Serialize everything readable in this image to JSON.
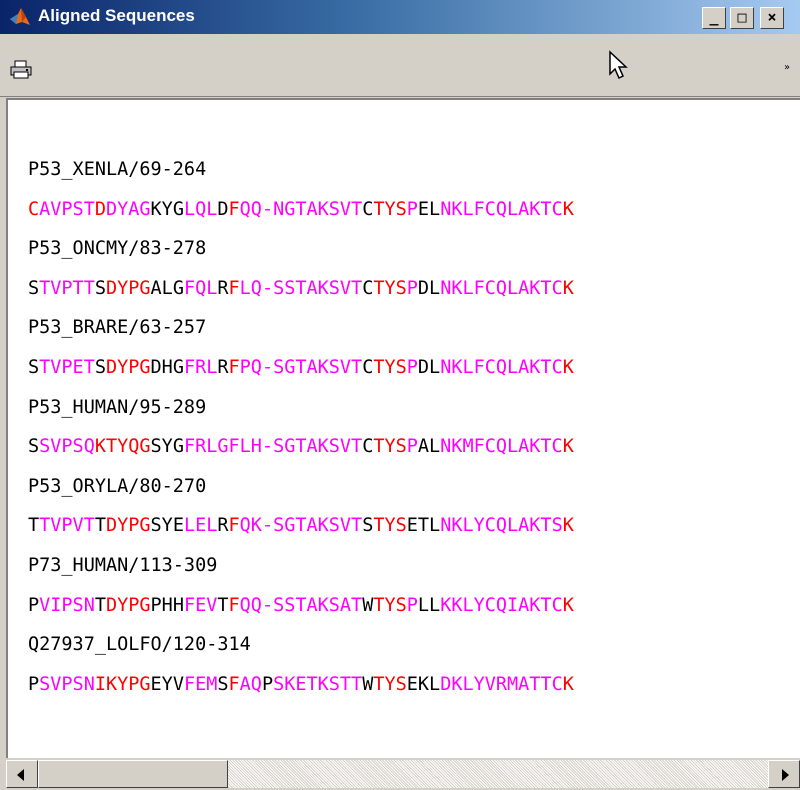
{
  "window": {
    "title": "Aligned Sequences",
    "controls": {
      "minimize": "_",
      "maximize": "□",
      "close": "×"
    }
  },
  "toolbar": {
    "print_icon": "printer-icon",
    "overflow_glyph": "»"
  },
  "colors": {
    "titlebar_start": "#0a246a",
    "titlebar_end": "#a6caf0",
    "residue_red": "#ff0000",
    "residue_magenta": "#ff00ff",
    "residue_black": "#000000"
  },
  "sequences": [
    {
      "name": "P53_XENLA/69-264",
      "segments": [
        {
          "t": "C",
          "c": "red"
        },
        {
          "t": "AVPST",
          "c": "magenta"
        },
        {
          "t": "D",
          "c": "red"
        },
        {
          "t": "DYAG",
          "c": "magenta"
        },
        {
          "t": "KYG",
          "c": "black"
        },
        {
          "t": "LQL",
          "c": "magenta"
        },
        {
          "t": "D",
          "c": "black"
        },
        {
          "t": "F",
          "c": "red"
        },
        {
          "t": "QQ-",
          "c": "magenta"
        },
        {
          "t": "NGTAKSVT",
          "c": "magenta"
        },
        {
          "t": "C",
          "c": "black"
        },
        {
          "t": "TYS",
          "c": "red"
        },
        {
          "t": "P",
          "c": "magenta"
        },
        {
          "t": "EL",
          "c": "black"
        },
        {
          "t": "NKLFCQLAKTC",
          "c": "magenta"
        },
        {
          "t": "K",
          "c": "red"
        }
      ]
    },
    {
      "name": "P53_ONCMY/83-278",
      "segments": [
        {
          "t": "S",
          "c": "black"
        },
        {
          "t": "TVPTT",
          "c": "magenta"
        },
        {
          "t": "S",
          "c": "black"
        },
        {
          "t": "DYPG",
          "c": "red"
        },
        {
          "t": "ALG",
          "c": "black"
        },
        {
          "t": "FQL",
          "c": "magenta"
        },
        {
          "t": "R",
          "c": "black"
        },
        {
          "t": "F",
          "c": "red"
        },
        {
          "t": "LQ-",
          "c": "magenta"
        },
        {
          "t": "SSTAKSVT",
          "c": "magenta"
        },
        {
          "t": "C",
          "c": "black"
        },
        {
          "t": "TYS",
          "c": "red"
        },
        {
          "t": "P",
          "c": "magenta"
        },
        {
          "t": "DL",
          "c": "black"
        },
        {
          "t": "NKLFCQLAKTC",
          "c": "magenta"
        },
        {
          "t": "K",
          "c": "red"
        }
      ]
    },
    {
      "name": "P53_BRARE/63-257",
      "segments": [
        {
          "t": "S",
          "c": "black"
        },
        {
          "t": "TVPET",
          "c": "magenta"
        },
        {
          "t": "S",
          "c": "black"
        },
        {
          "t": "DYPG",
          "c": "red"
        },
        {
          "t": "DHG",
          "c": "black"
        },
        {
          "t": "FRL",
          "c": "magenta"
        },
        {
          "t": "R",
          "c": "black"
        },
        {
          "t": "F",
          "c": "red"
        },
        {
          "t": "PQ-",
          "c": "magenta"
        },
        {
          "t": "SGTAKSVT",
          "c": "magenta"
        },
        {
          "t": "C",
          "c": "black"
        },
        {
          "t": "TYS",
          "c": "red"
        },
        {
          "t": "P",
          "c": "magenta"
        },
        {
          "t": "DL",
          "c": "black"
        },
        {
          "t": "NKLFCQLAKTC",
          "c": "magenta"
        },
        {
          "t": "K",
          "c": "red"
        }
      ]
    },
    {
      "name": "P53_HUMAN/95-289",
      "segments": [
        {
          "t": "S",
          "c": "black"
        },
        {
          "t": "SVPSQ",
          "c": "magenta"
        },
        {
          "t": "KTYQG",
          "c": "red"
        },
        {
          "t": "SYG",
          "c": "black"
        },
        {
          "t": "FRLGFL",
          "c": "magenta"
        },
        {
          "t": "H-",
          "c": "magenta"
        },
        {
          "t": "SGTAKSVT",
          "c": "magenta"
        },
        {
          "t": "C",
          "c": "black"
        },
        {
          "t": "TYS",
          "c": "red"
        },
        {
          "t": "P",
          "c": "magenta"
        },
        {
          "t": "AL",
          "c": "black"
        },
        {
          "t": "NKMFCQLAKTC",
          "c": "magenta"
        },
        {
          "t": "K",
          "c": "red"
        }
      ]
    },
    {
      "name": "P53_ORYLA/80-270",
      "segments": [
        {
          "t": "T",
          "c": "black"
        },
        {
          "t": "TVPVT",
          "c": "magenta"
        },
        {
          "t": "T",
          "c": "black"
        },
        {
          "t": "DYPG",
          "c": "red"
        },
        {
          "t": "SYE",
          "c": "black"
        },
        {
          "t": "LEL",
          "c": "magenta"
        },
        {
          "t": "R",
          "c": "black"
        },
        {
          "t": "F",
          "c": "red"
        },
        {
          "t": "QK-",
          "c": "magenta"
        },
        {
          "t": "SGTAKSVT",
          "c": "magenta"
        },
        {
          "t": "S",
          "c": "black"
        },
        {
          "t": "TYS",
          "c": "red"
        },
        {
          "t": "ET",
          "c": "black"
        },
        {
          "t": "L",
          "c": "black"
        },
        {
          "t": "NKLYCQLAKTS",
          "c": "magenta"
        },
        {
          "t": "K",
          "c": "red"
        }
      ]
    },
    {
      "name": "P73_HUMAN/113-309",
      "segments": [
        {
          "t": "P",
          "c": "black"
        },
        {
          "t": "VIPSN",
          "c": "magenta"
        },
        {
          "t": "T",
          "c": "black"
        },
        {
          "t": "DYPG",
          "c": "red"
        },
        {
          "t": "PHH",
          "c": "black"
        },
        {
          "t": "FEV",
          "c": "magenta"
        },
        {
          "t": "T",
          "c": "black"
        },
        {
          "t": "F",
          "c": "red"
        },
        {
          "t": "QQ-",
          "c": "magenta"
        },
        {
          "t": "SSTAKSAT",
          "c": "magenta"
        },
        {
          "t": "W",
          "c": "black"
        },
        {
          "t": "TYS",
          "c": "red"
        },
        {
          "t": "P",
          "c": "magenta"
        },
        {
          "t": "LL",
          "c": "black"
        },
        {
          "t": "KKLYCQIAKTC",
          "c": "magenta"
        },
        {
          "t": "K",
          "c": "red"
        }
      ]
    },
    {
      "name": "Q27937_LOLFO/120-314",
      "segments": [
        {
          "t": "P",
          "c": "black"
        },
        {
          "t": "SVPSN",
          "c": "magenta"
        },
        {
          "t": "IKYPG",
          "c": "red"
        },
        {
          "t": "EYV",
          "c": "black"
        },
        {
          "t": "FEM",
          "c": "magenta"
        },
        {
          "t": "S",
          "c": "black"
        },
        {
          "t": "F",
          "c": "red"
        },
        {
          "t": "AQ",
          "c": "magenta"
        },
        {
          "t": "P",
          "c": "black"
        },
        {
          "t": "SKETKSTT",
          "c": "magenta"
        },
        {
          "t": "W",
          "c": "black"
        },
        {
          "t": "TYS",
          "c": "red"
        },
        {
          "t": "EKL",
          "c": "black"
        },
        {
          "t": "DKLYVRMATTC",
          "c": "magenta"
        },
        {
          "t": "K",
          "c": "red"
        }
      ]
    }
  ],
  "scrollbar": {
    "left_arrow": "left-arrow-icon",
    "right_arrow": "right-arrow-icon",
    "thumb_position": 0
  }
}
